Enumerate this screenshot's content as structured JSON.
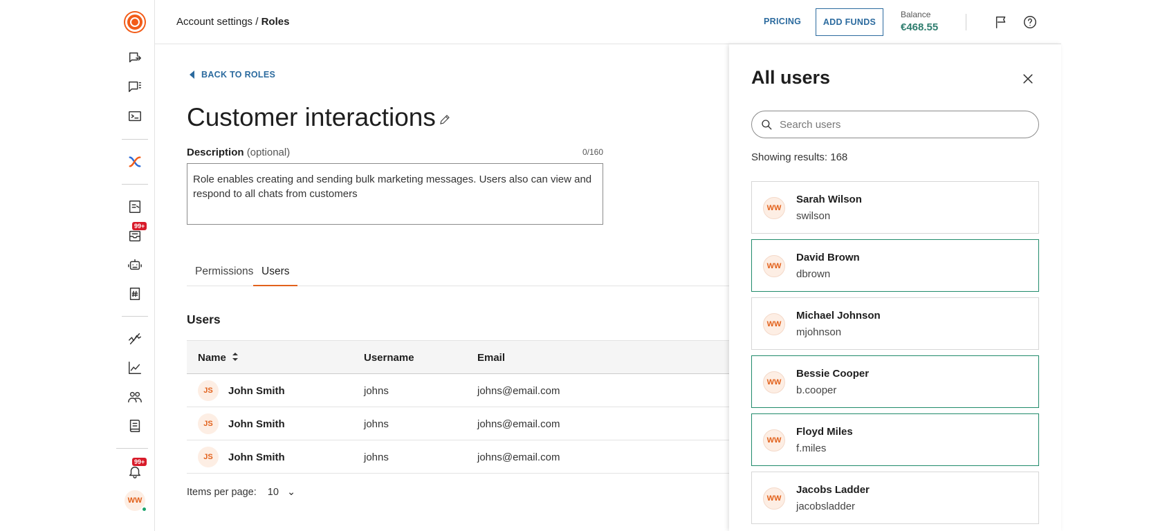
{
  "sidebar": {
    "notification_badges": [
      "99+",
      "99+"
    ],
    "avatar_initials": "WW"
  },
  "header": {
    "breadcrumb_parent": "Account settings",
    "breadcrumb_separator": " / ",
    "breadcrumb_current": "Roles",
    "pricing_label": "PRICING",
    "add_funds_label": "ADD FUNDS",
    "balance_label": "Balance",
    "balance_value": "€468.55"
  },
  "role": {
    "back_label": "BACK TO ROLES",
    "title": "Customer interactions",
    "description_label": "Description",
    "description_optional": "(optional)",
    "char_count": "0/160",
    "description_text": "Role enables creating and sending bulk marketing messages. Users also can view and respond to all chats from customers"
  },
  "tabs": [
    {
      "label": "Permissions",
      "active": false
    },
    {
      "label": "Users",
      "active": true
    }
  ],
  "users_section": {
    "title": "Users",
    "columns": [
      "Name",
      "Username",
      "Email"
    ],
    "rows": [
      {
        "initials": "JS",
        "name": "John Smith",
        "username": "johns",
        "email": "johns@email.com"
      },
      {
        "initials": "JS",
        "name": "John Smith",
        "username": "johns",
        "email": "johns@email.com"
      },
      {
        "initials": "JS",
        "name": "John Smith",
        "username": "johns",
        "email": "johns@email.com"
      }
    ],
    "pager_label": "Items per page:",
    "pager_value": "10"
  },
  "drawer": {
    "title": "All users",
    "search_placeholder": "Search users",
    "results_text": "Showing results: 168",
    "users": [
      {
        "initials": "WW",
        "name": "Sarah Wilson",
        "username": "swilson",
        "selected": false
      },
      {
        "initials": "WW",
        "name": "David Brown",
        "username": "dbrown",
        "selected": true
      },
      {
        "initials": "WW",
        "name": "Michael Johnson",
        "username": "mjohnson",
        "selected": false
      },
      {
        "initials": "WW",
        "name": "Bessie Cooper",
        "username": "b.cooper",
        "selected": true
      },
      {
        "initials": "WW",
        "name": "Floyd Miles",
        "username": "f.miles",
        "selected": true
      },
      {
        "initials": "WW",
        "name": "Jacobs Ladder",
        "username": "jacobsladder",
        "selected": false
      }
    ]
  },
  "colors": {
    "brand": "#f25c19",
    "accent_link": "#2b6a9e",
    "selected_border": "#1f8a6a",
    "balance": "#2e7d6e",
    "badge": "#d81b2a"
  }
}
